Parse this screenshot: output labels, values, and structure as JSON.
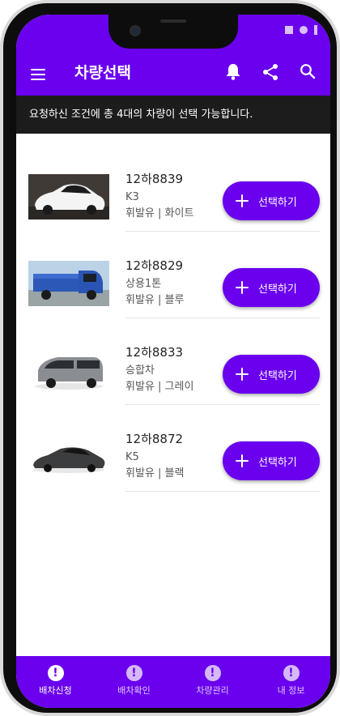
{
  "appbar": {
    "title": "차량선택"
  },
  "notice": {
    "text": "요청하신 조건에 총 4대의 차량이 선택 가능합니다."
  },
  "vehicles": [
    {
      "plate": "12하8839",
      "model": "K3",
      "spec": "휘발유 | 화이트",
      "button_label": "선택하기",
      "image": "white-sedan-photo"
    },
    {
      "plate": "12하8829",
      "model": "상용1톤",
      "spec": "휘발유 | 블루",
      "button_label": "선택하기",
      "image": "blue-truck-photo"
    },
    {
      "plate": "12하8833",
      "model": "승합차",
      "spec": "휘발유 | 그레이",
      "button_label": "선택하기",
      "image": "gray-van-photo"
    },
    {
      "plate": "12하8872",
      "model": "K5",
      "spec": "휘발유 | 블랙",
      "button_label": "선택하기",
      "image": "black-sedan-photo"
    }
  ],
  "bottom_nav": [
    {
      "label": "배차신청",
      "active": true
    },
    {
      "label": "배차확인",
      "active": false
    },
    {
      "label": "차량관리",
      "active": false
    },
    {
      "label": "내 정보",
      "active": false
    }
  ],
  "colors": {
    "primary": "#6a00ee",
    "notice_bg": "#1c1c1c",
    "surface": "#ffffff"
  }
}
